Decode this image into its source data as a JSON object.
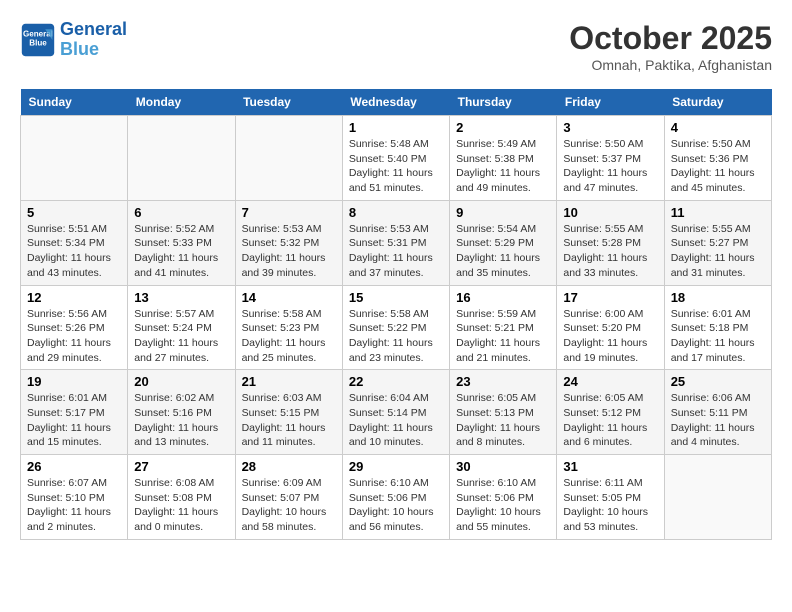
{
  "header": {
    "logo_line1": "General",
    "logo_line2": "Blue",
    "month": "October 2025",
    "location": "Omnah, Paktika, Afghanistan"
  },
  "days_of_week": [
    "Sunday",
    "Monday",
    "Tuesday",
    "Wednesday",
    "Thursday",
    "Friday",
    "Saturday"
  ],
  "weeks": [
    [
      {
        "num": "",
        "info": ""
      },
      {
        "num": "",
        "info": ""
      },
      {
        "num": "",
        "info": ""
      },
      {
        "num": "1",
        "info": "Sunrise: 5:48 AM\nSunset: 5:40 PM\nDaylight: 11 hours\nand 51 minutes."
      },
      {
        "num": "2",
        "info": "Sunrise: 5:49 AM\nSunset: 5:38 PM\nDaylight: 11 hours\nand 49 minutes."
      },
      {
        "num": "3",
        "info": "Sunrise: 5:50 AM\nSunset: 5:37 PM\nDaylight: 11 hours\nand 47 minutes."
      },
      {
        "num": "4",
        "info": "Sunrise: 5:50 AM\nSunset: 5:36 PM\nDaylight: 11 hours\nand 45 minutes."
      }
    ],
    [
      {
        "num": "5",
        "info": "Sunrise: 5:51 AM\nSunset: 5:34 PM\nDaylight: 11 hours\nand 43 minutes."
      },
      {
        "num": "6",
        "info": "Sunrise: 5:52 AM\nSunset: 5:33 PM\nDaylight: 11 hours\nand 41 minutes."
      },
      {
        "num": "7",
        "info": "Sunrise: 5:53 AM\nSunset: 5:32 PM\nDaylight: 11 hours\nand 39 minutes."
      },
      {
        "num": "8",
        "info": "Sunrise: 5:53 AM\nSunset: 5:31 PM\nDaylight: 11 hours\nand 37 minutes."
      },
      {
        "num": "9",
        "info": "Sunrise: 5:54 AM\nSunset: 5:29 PM\nDaylight: 11 hours\nand 35 minutes."
      },
      {
        "num": "10",
        "info": "Sunrise: 5:55 AM\nSunset: 5:28 PM\nDaylight: 11 hours\nand 33 minutes."
      },
      {
        "num": "11",
        "info": "Sunrise: 5:55 AM\nSunset: 5:27 PM\nDaylight: 11 hours\nand 31 minutes."
      }
    ],
    [
      {
        "num": "12",
        "info": "Sunrise: 5:56 AM\nSunset: 5:26 PM\nDaylight: 11 hours\nand 29 minutes."
      },
      {
        "num": "13",
        "info": "Sunrise: 5:57 AM\nSunset: 5:24 PM\nDaylight: 11 hours\nand 27 minutes."
      },
      {
        "num": "14",
        "info": "Sunrise: 5:58 AM\nSunset: 5:23 PM\nDaylight: 11 hours\nand 25 minutes."
      },
      {
        "num": "15",
        "info": "Sunrise: 5:58 AM\nSunset: 5:22 PM\nDaylight: 11 hours\nand 23 minutes."
      },
      {
        "num": "16",
        "info": "Sunrise: 5:59 AM\nSunset: 5:21 PM\nDaylight: 11 hours\nand 21 minutes."
      },
      {
        "num": "17",
        "info": "Sunrise: 6:00 AM\nSunset: 5:20 PM\nDaylight: 11 hours\nand 19 minutes."
      },
      {
        "num": "18",
        "info": "Sunrise: 6:01 AM\nSunset: 5:18 PM\nDaylight: 11 hours\nand 17 minutes."
      }
    ],
    [
      {
        "num": "19",
        "info": "Sunrise: 6:01 AM\nSunset: 5:17 PM\nDaylight: 11 hours\nand 15 minutes."
      },
      {
        "num": "20",
        "info": "Sunrise: 6:02 AM\nSunset: 5:16 PM\nDaylight: 11 hours\nand 13 minutes."
      },
      {
        "num": "21",
        "info": "Sunrise: 6:03 AM\nSunset: 5:15 PM\nDaylight: 11 hours\nand 11 minutes."
      },
      {
        "num": "22",
        "info": "Sunrise: 6:04 AM\nSunset: 5:14 PM\nDaylight: 11 hours\nand 10 minutes."
      },
      {
        "num": "23",
        "info": "Sunrise: 6:05 AM\nSunset: 5:13 PM\nDaylight: 11 hours\nand 8 minutes."
      },
      {
        "num": "24",
        "info": "Sunrise: 6:05 AM\nSunset: 5:12 PM\nDaylight: 11 hours\nand 6 minutes."
      },
      {
        "num": "25",
        "info": "Sunrise: 6:06 AM\nSunset: 5:11 PM\nDaylight: 11 hours\nand 4 minutes."
      }
    ],
    [
      {
        "num": "26",
        "info": "Sunrise: 6:07 AM\nSunset: 5:10 PM\nDaylight: 11 hours\nand 2 minutes."
      },
      {
        "num": "27",
        "info": "Sunrise: 6:08 AM\nSunset: 5:08 PM\nDaylight: 11 hours\nand 0 minutes."
      },
      {
        "num": "28",
        "info": "Sunrise: 6:09 AM\nSunset: 5:07 PM\nDaylight: 10 hours\nand 58 minutes."
      },
      {
        "num": "29",
        "info": "Sunrise: 6:10 AM\nSunset: 5:06 PM\nDaylight: 10 hours\nand 56 minutes."
      },
      {
        "num": "30",
        "info": "Sunrise: 6:10 AM\nSunset: 5:06 PM\nDaylight: 10 hours\nand 55 minutes."
      },
      {
        "num": "31",
        "info": "Sunrise: 6:11 AM\nSunset: 5:05 PM\nDaylight: 10 hours\nand 53 minutes."
      },
      {
        "num": "",
        "info": ""
      }
    ]
  ]
}
